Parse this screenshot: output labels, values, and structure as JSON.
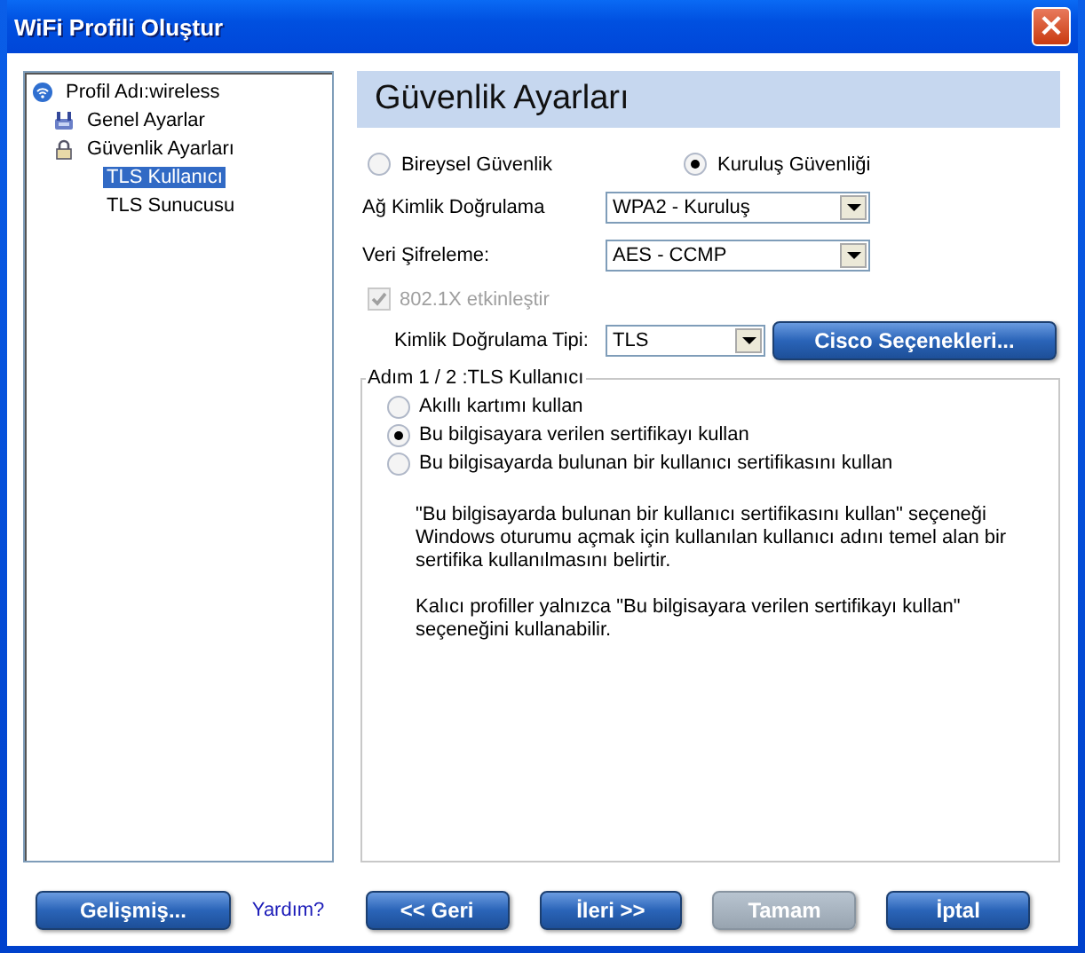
{
  "window": {
    "title": "WiFi Profili Oluştur",
    "close": "×"
  },
  "tree": [
    {
      "label": "Profil Adı:wireless",
      "kind": "profile",
      "selected": false,
      "children": [
        {
          "label": "Genel Ayarlar",
          "kind": "general",
          "selected": false
        },
        {
          "label": "Güvenlik Ayarları",
          "kind": "security",
          "selected": false,
          "children": [
            {
              "label": "TLS Kullanıcı",
              "kind": "page",
              "selected": true
            },
            {
              "label": "TLS Sunucusu",
              "kind": "page",
              "selected": false
            }
          ]
        }
      ]
    }
  ],
  "header": "Güvenlik Ayarları",
  "security_modes": [
    {
      "label": "Bireysel Güvenlik",
      "selected": false
    },
    {
      "label": "Kuruluş Güvenliği",
      "selected": true
    }
  ],
  "fields": [
    {
      "label": "Ağ Kimlik Doğrulama",
      "value": "WPA2 - Kuruluş"
    },
    {
      "label": "Veri Şifreleme:",
      "value": "AES - CCMP"
    }
  ],
  "enable_8021x": {
    "label": "802.1X etkinleştir",
    "checked": true,
    "disabled": true
  },
  "auth_type": {
    "label": "Kimlik Doğrulama Tipi:",
    "value": "TLS"
  },
  "cisco_button": "Cisco Seçenekleri...",
  "group": {
    "title": "Adım 1 / 2 :TLS Kullanıcı",
    "options": [
      {
        "label": "Akıllı kartımı kullan",
        "selected": false
      },
      {
        "label": "Bu bilgisayara verilen sertifikayı kullan",
        "selected": true
      },
      {
        "label": "Bu bilgisayarda bulunan bir kullanıcı sertifikasını kullan",
        "selected": false
      }
    ],
    "notes": [
      "\"Bu bilgisayarda bulunan bir kullanıcı sertifikasını kullan\" seçeneği Windows oturumu açmak için kullanılan kullanıcı adını temel alan bir sertifika kullanılmasını belirtir.",
      "Kalıcı profiller yalnızca \"Bu bilgisayara verilen sertifikayı kullan\" seçeneğini kullanabilir."
    ]
  },
  "buttons": [
    {
      "label": "Gelişmiş...",
      "kind": "button",
      "disabled": false
    },
    {
      "label": "Yardım?",
      "kind": "link"
    },
    {
      "label": "<< Geri",
      "kind": "button",
      "disabled": false
    },
    {
      "label": "İleri >>",
      "kind": "button",
      "disabled": false
    },
    {
      "label": "Tamam",
      "kind": "button",
      "disabled": true
    },
    {
      "label": "İptal",
      "kind": "button",
      "disabled": false
    }
  ]
}
